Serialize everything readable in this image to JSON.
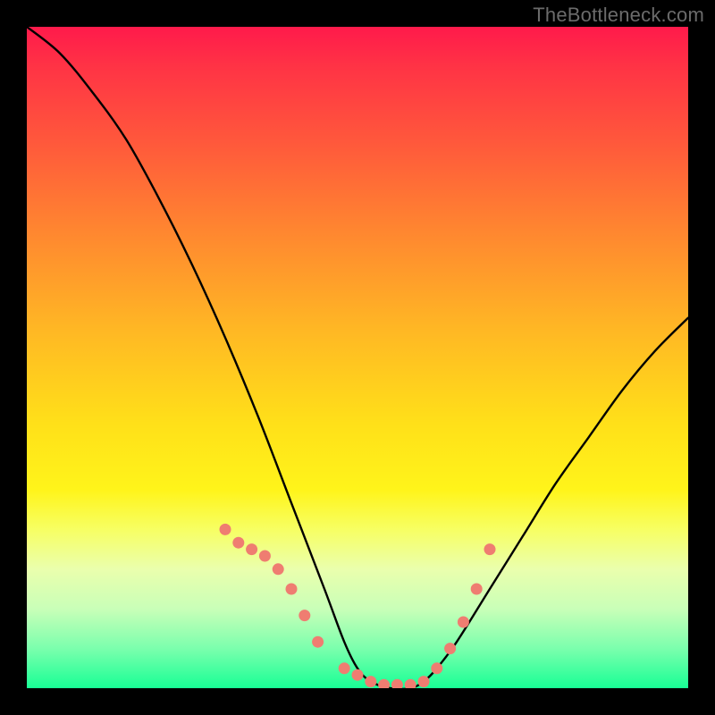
{
  "watermark": "TheBottleneck.com",
  "colors": {
    "page_bg": "#000000",
    "curve": "#000000",
    "marker": "#ef7d71",
    "gradient_stops": [
      "#ff1a4b",
      "#ff3345",
      "#ff5a3b",
      "#ff8a2f",
      "#ffb824",
      "#ffe019",
      "#fff41a",
      "#f7ff63",
      "#eaffad",
      "#c9ffb8",
      "#7bffad",
      "#18ff95"
    ]
  },
  "chart_data": {
    "type": "line",
    "title": "",
    "xlabel": "",
    "ylabel": "",
    "xlim": [
      0,
      100
    ],
    "ylim": [
      0,
      100
    ],
    "grid": false,
    "legend": false,
    "annotations": [
      "TheBottleneck.com"
    ],
    "note": "Values trace an asymmetric V-shaped curve; y is read as height relative to the plot area (100 = top, 0 = bottom). Minimum (≈0) lies on a plateau around x 50–60. Left branch starts near top-left and descends steeply; right branch rises more gently toward x=100.",
    "series": [
      {
        "name": "curve",
        "x": [
          0,
          5,
          10,
          15,
          20,
          25,
          30,
          35,
          40,
          45,
          48,
          50,
          52,
          55,
          58,
          60,
          62,
          65,
          70,
          75,
          80,
          85,
          90,
          95,
          100
        ],
        "y": [
          100,
          96,
          90,
          83,
          74,
          64,
          53,
          41,
          28,
          15,
          7,
          3,
          1,
          0,
          0,
          1,
          3,
          7,
          15,
          23,
          31,
          38,
          45,
          51,
          56
        ]
      }
    ],
    "markers": {
      "name": "highlight-dots",
      "note": "Salmon dots clustered along the curve near the trough and lower flanks (roughly x 30–45 descending, the bottom plateau x 48–60, and x 62–70 ascending).",
      "x": [
        30,
        32,
        34,
        36,
        38,
        40,
        42,
        44,
        48,
        50,
        52,
        54,
        56,
        58,
        60,
        62,
        64,
        66,
        68,
        70
      ],
      "y": [
        24,
        22,
        21,
        20,
        18,
        15,
        11,
        7,
        3,
        2,
        1,
        0.5,
        0.5,
        0.5,
        1,
        3,
        6,
        10,
        15,
        21
      ]
    }
  }
}
